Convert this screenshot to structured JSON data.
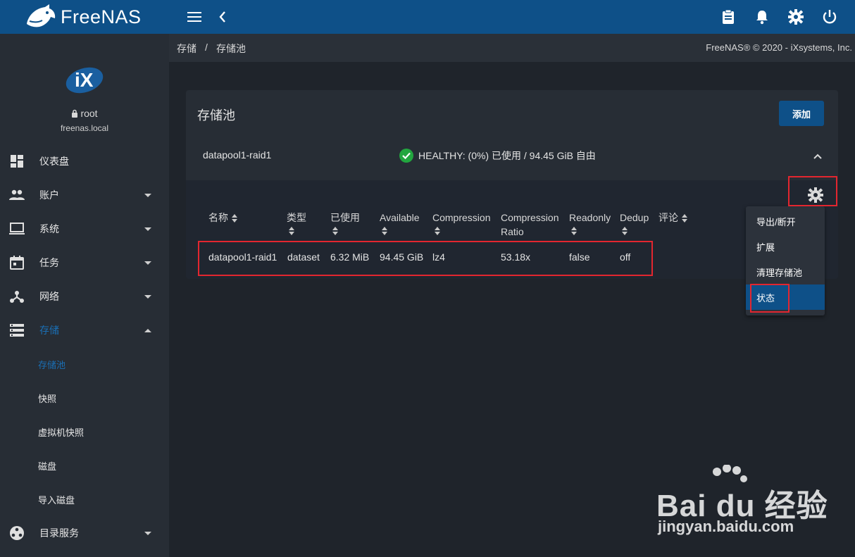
{
  "app": {
    "name": "FreeNAS",
    "logo_text": "FreeNAS"
  },
  "topbar": {
    "icons": [
      "menu-icon",
      "back-chevron-icon",
      "clipboard-icon",
      "bell-icon",
      "gear-icon",
      "power-icon"
    ]
  },
  "sidebar": {
    "logo_text": "iX",
    "user": "root",
    "host": "freenas.local",
    "items": [
      {
        "label": "仪表盘",
        "icon": "dashboard-icon"
      },
      {
        "label": "账户",
        "icon": "people-icon"
      },
      {
        "label": "系统",
        "icon": "computer-icon"
      },
      {
        "label": "任务",
        "icon": "calendar-icon"
      },
      {
        "label": "网络",
        "icon": "network-icon"
      },
      {
        "label": "存储",
        "icon": "storage-icon"
      },
      {
        "label": "目录服务",
        "icon": "directory-icon"
      }
    ],
    "storage_sub": [
      "存储池",
      "快照",
      "虚拟机快照",
      "磁盘",
      "导入磁盘"
    ]
  },
  "breadcrumb": {
    "root": "存储",
    "separator": "/",
    "current": "存储池"
  },
  "copyright": "FreeNAS® © 2020 - iXsystems, Inc.",
  "card": {
    "title": "存储池",
    "add_label": "添加"
  },
  "pool": {
    "name": "datapool1-raid1",
    "status": "HEALTHY: (0%) 已使用 / 94.45 GiB 自由",
    "columns": [
      "名称",
      "类型",
      "已使用",
      "Available",
      "Compression",
      "Compression",
      "Ratio",
      "Readonly",
      "Dedup",
      "评论"
    ],
    "row": {
      "name": "datapool1-raid1",
      "type": "dataset",
      "used": "6.32 MiB",
      "available": "94.45 GiB",
      "compression": "lz4",
      "ratio": "53.18x",
      "readonly": "false",
      "dedup": "off",
      "comment": ""
    }
  },
  "menu": {
    "items": [
      "导出/断开",
      "扩展",
      "清理存储池",
      "状态"
    ],
    "active": "状态"
  },
  "watermark": {
    "main": "Bai du 经验",
    "sub": "jingyan.baidu.com"
  },
  "colors": {
    "topbar": "#0e5088",
    "sidebar": "#272d35",
    "accent": "#1a6fb5",
    "healthy": "#22a63f",
    "highlight": "#e3262f"
  }
}
